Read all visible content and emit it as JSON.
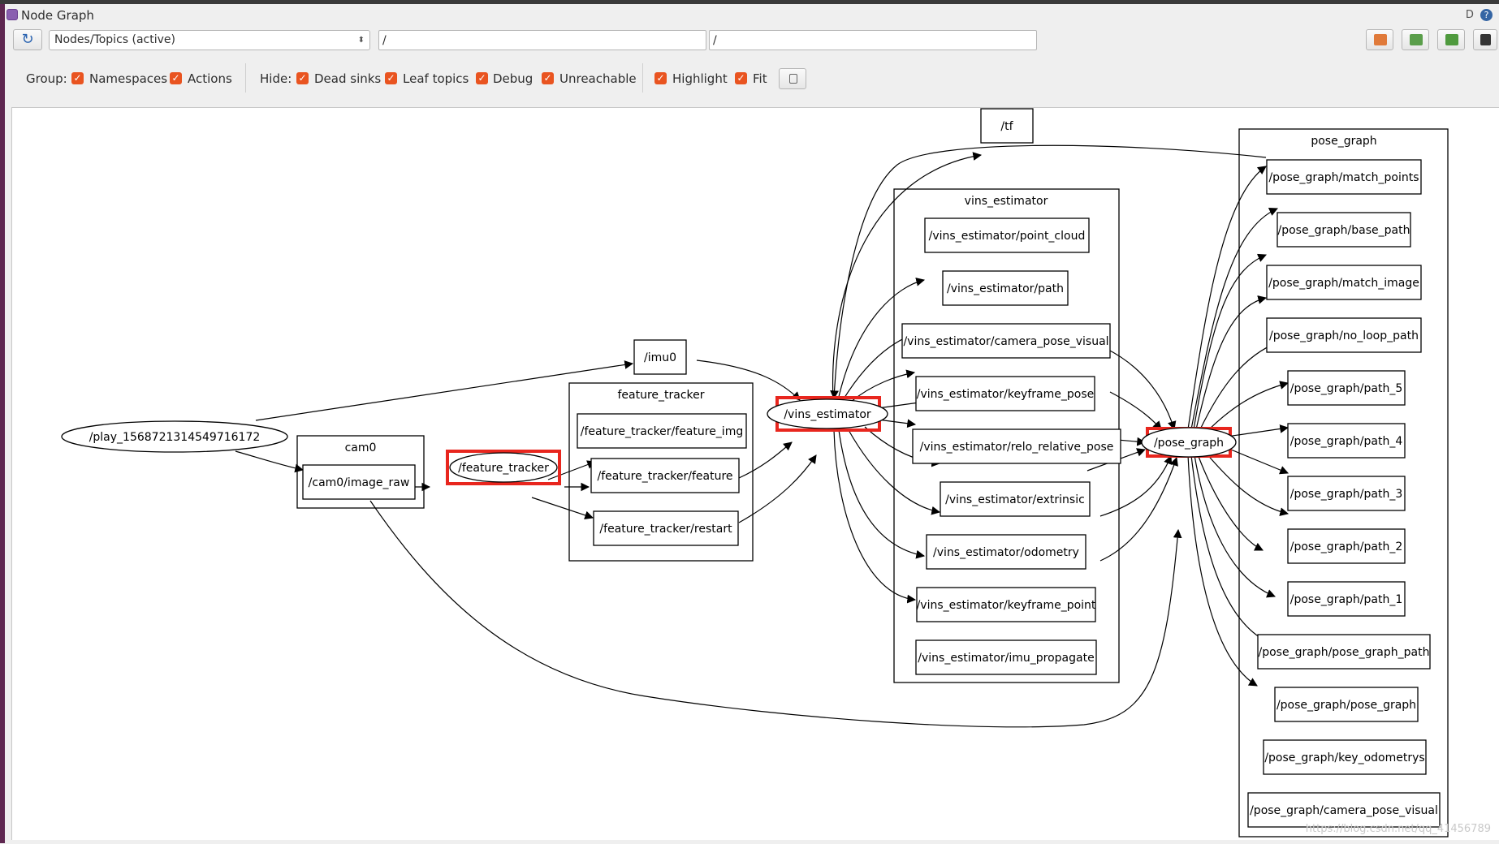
{
  "window": {
    "title": "Node Graph",
    "title_right": "D",
    "help_icon": "?"
  },
  "toolbar": {
    "refresh_icon": "refresh-icon",
    "mode_combo": "Nodes/Topics (active)",
    "node_filter": "/",
    "topic_filter": "/",
    "right_icons": [
      "load-dot-icon",
      "save-dot-icon",
      "save-image-icon",
      "screenshot-icon"
    ]
  },
  "options": {
    "group_label": "Group:",
    "hide_label": "Hide:",
    "items": [
      {
        "label": "Namespaces",
        "checked": true
      },
      {
        "label": "Actions",
        "checked": true
      },
      {
        "label": "Dead sinks",
        "checked": true
      },
      {
        "label": "Leaf topics",
        "checked": true
      },
      {
        "label": "Debug",
        "checked": true
      },
      {
        "label": "Unreachable",
        "checked": true
      },
      {
        "label": "Highlight",
        "checked": true
      },
      {
        "label": "Fit",
        "checked": true
      }
    ]
  },
  "graph": {
    "highlight_color": "#e8261e",
    "clusters": [
      "cam0",
      "feature_tracker",
      "vins_estimator",
      "pose_graph"
    ],
    "nodes": {
      "play": "/play_1568721314549716172",
      "feature_tracker": "/feature_tracker",
      "vins_estimator": "/vins_estimator",
      "pose_graph": "/pose_graph"
    },
    "topics": {
      "imu0": "/imu0",
      "tf": "/tf",
      "cam0_image_raw": "/cam0/image_raw",
      "ft_feature_img": "/feature_tracker/feature_img",
      "ft_feature": "/feature_tracker/feature",
      "ft_restart": "/feature_tracker/restart",
      "ve_point_cloud": "/vins_estimator/point_cloud",
      "ve_path": "/vins_estimator/path",
      "ve_camera_pose_visual": "/vins_estimator/camera_pose_visual",
      "ve_keyframe_pose": "/vins_estimator/keyframe_pose",
      "ve_relo_relative_pose": "/vins_estimator/relo_relative_pose",
      "ve_extrinsic": "/vins_estimator/extrinsic",
      "ve_odometry": "/vins_estimator/odometry",
      "ve_keyframe_point": "/vins_estimator/keyframe_point",
      "ve_imu_propagate": "/vins_estimator/imu_propagate",
      "pg_match_points": "/pose_graph/match_points",
      "pg_base_path": "/pose_graph/base_path",
      "pg_match_image": "/pose_graph/match_image",
      "pg_no_loop_path": "/pose_graph/no_loop_path",
      "pg_path_5": "/pose_graph/path_5",
      "pg_path_4": "/pose_graph/path_4",
      "pg_path_3": "/pose_graph/path_3",
      "pg_path_2": "/pose_graph/path_2",
      "pg_path_1": "/pose_graph/path_1",
      "pg_pose_graph_path": "/pose_graph/pose_graph_path",
      "pg_pose_graph": "/pose_graph/pose_graph",
      "pg_key_odometrys": "/pose_graph/key_odometrys",
      "pg_camera_pose_visual": "/pose_graph/camera_pose_visual"
    }
  },
  "watermark": "https://blog.csdn.net/qq_41456789"
}
